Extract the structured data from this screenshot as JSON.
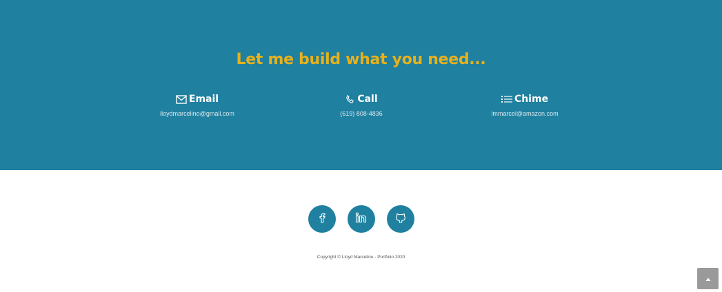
{
  "contact": {
    "headline": "Let me build what you need...",
    "items": [
      {
        "icon": "envelope-icon",
        "title": "Email",
        "value": "lloydmarcelino@gmail.com"
      },
      {
        "icon": "phone-icon",
        "title": "Call",
        "value": "(619) 808-4836"
      },
      {
        "icon": "list-icon",
        "title": "Chime",
        "value": "lmmarcel@amazon.com"
      }
    ]
  },
  "social": {
    "links": [
      {
        "icon": "facebook-icon",
        "label": "f"
      },
      {
        "icon": "linkedin-icon",
        "label": "in"
      },
      {
        "icon": "github-icon",
        "label": ""
      }
    ]
  },
  "footer": {
    "copyright": "Copyright © Lloyd Marcelino - Portfolio 2020"
  },
  "colors": {
    "section_bg": "#1f80a0",
    "headline": "#e6b11c",
    "scroll_top_bg": "#9a9a9a"
  }
}
